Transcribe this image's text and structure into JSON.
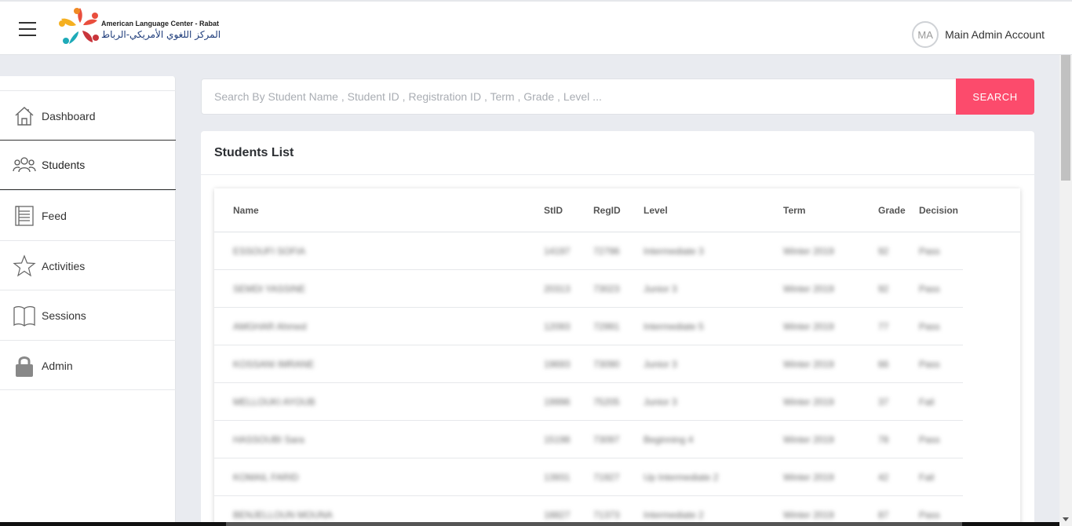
{
  "header": {
    "logo_en": "American Language Center - Rabat",
    "logo_ar": "المركز اللغوي الأمريكي-الرباط",
    "avatar_initials": "MA",
    "user_name": "Main Admin Account"
  },
  "sidebar": {
    "items": [
      {
        "label": "Dashboard",
        "icon": "home-icon"
      },
      {
        "label": "Students",
        "icon": "users-icon",
        "active": true
      },
      {
        "label": "Feed",
        "icon": "feed-icon"
      },
      {
        "label": "Activities",
        "icon": "star-icon"
      },
      {
        "label": "Sessions",
        "icon": "book-icon"
      },
      {
        "label": "Admin",
        "icon": "lock-icon"
      }
    ]
  },
  "search": {
    "placeholder": "Search By Student Name , Student ID , Registration ID , Term , Grade , Level ...",
    "button_label": "SEARCH"
  },
  "students": {
    "title": "Students List",
    "columns": [
      "Name",
      "StID",
      "RegID",
      "Level",
      "Term",
      "Grade",
      "Decision"
    ],
    "rows": [
      [
        "ESSOUFI SOFIA",
        "14197",
        "72796",
        "Intermediate 3",
        "Winter 2019",
        "92",
        "Pass"
      ],
      [
        "SEMDI YASSINE",
        "20313",
        "73023",
        "Junior 3",
        "Winter 2019",
        "92",
        "Pass"
      ],
      [
        "AMGHAR Ahmed",
        "12093",
        "72991",
        "Intermediate 5",
        "Winter 2019",
        "77",
        "Pass"
      ],
      [
        "KOSSANI IMRANE",
        "19693",
        "73090",
        "Junior 3",
        "Winter 2019",
        "66",
        "Pass"
      ],
      [
        "MELLOUKI AYOUB",
        "19996",
        "75205",
        "Junior 3",
        "Winter 2019",
        "37",
        "Fail"
      ],
      [
        "HASSOUBI Sara",
        "15198",
        "73097",
        "Beginning 4",
        "Winter 2019",
        "78",
        "Pass"
      ],
      [
        "KOMAIL FARID",
        "13931",
        "71927",
        "Up Intermediate 2",
        "Winter 2019",
        "42",
        "Fail"
      ],
      [
        "BENJELLOUN MOUNA",
        "18827",
        "71373",
        "Intermediate 2",
        "Winter 2019",
        "87",
        "Pass"
      ]
    ]
  }
}
